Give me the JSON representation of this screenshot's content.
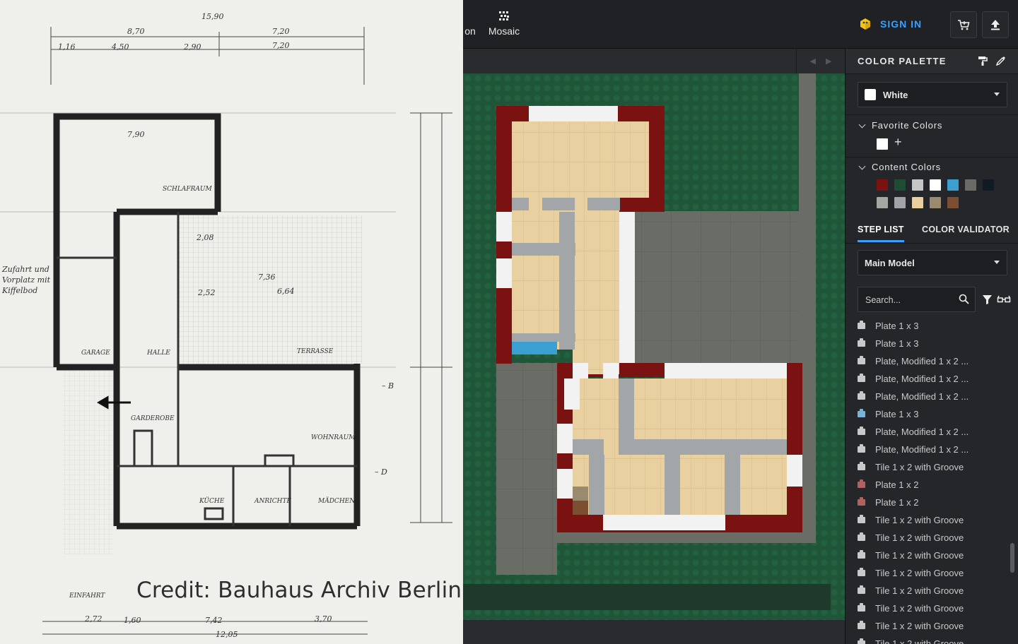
{
  "credit_text": "Credit: Bauhaus Archiv Berlin",
  "topbar": {
    "partial_tab_label": "on",
    "mosaic_label": "Mosaic",
    "signin_label": "SIGN IN",
    "icons": [
      "box-icon",
      "cart-icon",
      "upload-icon"
    ]
  },
  "palette": {
    "title": "COLOR PALETTE",
    "selected_color": "White",
    "favorite_title": "Favorite Colors",
    "favorite_colors": [
      "#ffffff"
    ],
    "content_title": "Content Colors",
    "content_colors": [
      "#7a1212",
      "#1f4d33",
      "#c6c6c6",
      "#ffffff",
      "#3b9fd2",
      "#6b6b66",
      "#0e1b24",
      "#a3a8a2",
      "#a0a3a8",
      "#e8cf9c",
      "#9b8b6e",
      "#7d4f32"
    ]
  },
  "tabs": {
    "steplist": "STEP LIST",
    "validator": "COLOR VALIDATOR"
  },
  "model_select": "Main Model",
  "search": {
    "placeholder": "Search..."
  },
  "steps": [
    {
      "label": "Plate 1 x 3",
      "color": "#c9c9c9"
    },
    {
      "label": "Plate 1 x 3",
      "color": "#c9c9c9"
    },
    {
      "label": "Plate, Modified 1 x 2 ...",
      "color": "#c9c9c9"
    },
    {
      "label": "Plate, Modified 1 x 2 ...",
      "color": "#c9c9c9"
    },
    {
      "label": "Plate, Modified 1 x 2 ...",
      "color": "#c9c9c9"
    },
    {
      "label": "Plate 1 x 3",
      "color": "#79b4d6"
    },
    {
      "label": "Plate, Modified 1 x 2 ...",
      "color": "#c9c9c9"
    },
    {
      "label": "Plate, Modified 1 x 2 ...",
      "color": "#c9c9c9"
    },
    {
      "label": "Tile 1 x 2 with Groove",
      "color": "#c9c9c9"
    },
    {
      "label": "Plate 1 x 2",
      "color": "#b26060"
    },
    {
      "label": "Plate 1 x 2",
      "color": "#b26060"
    },
    {
      "label": "Tile 1 x 2 with Groove",
      "color": "#c9c9c9"
    },
    {
      "label": "Tile 1 x 2 with Groove",
      "color": "#c9c9c9"
    },
    {
      "label": "Tile 1 x 2 with Groove",
      "color": "#c9c9c9"
    },
    {
      "label": "Tile 1 x 2 with Groove",
      "color": "#c9c9c9"
    },
    {
      "label": "Tile 1 x 2 with Groove",
      "color": "#c9c9c9"
    },
    {
      "label": "Tile 1 x 2 with Groove",
      "color": "#c9c9c9"
    },
    {
      "label": "Tile 1 x 2 with Groove",
      "color": "#c9c9c9"
    },
    {
      "label": "Tile 1 x 2 with Groove",
      "color": "#c9c9c9"
    }
  ]
}
